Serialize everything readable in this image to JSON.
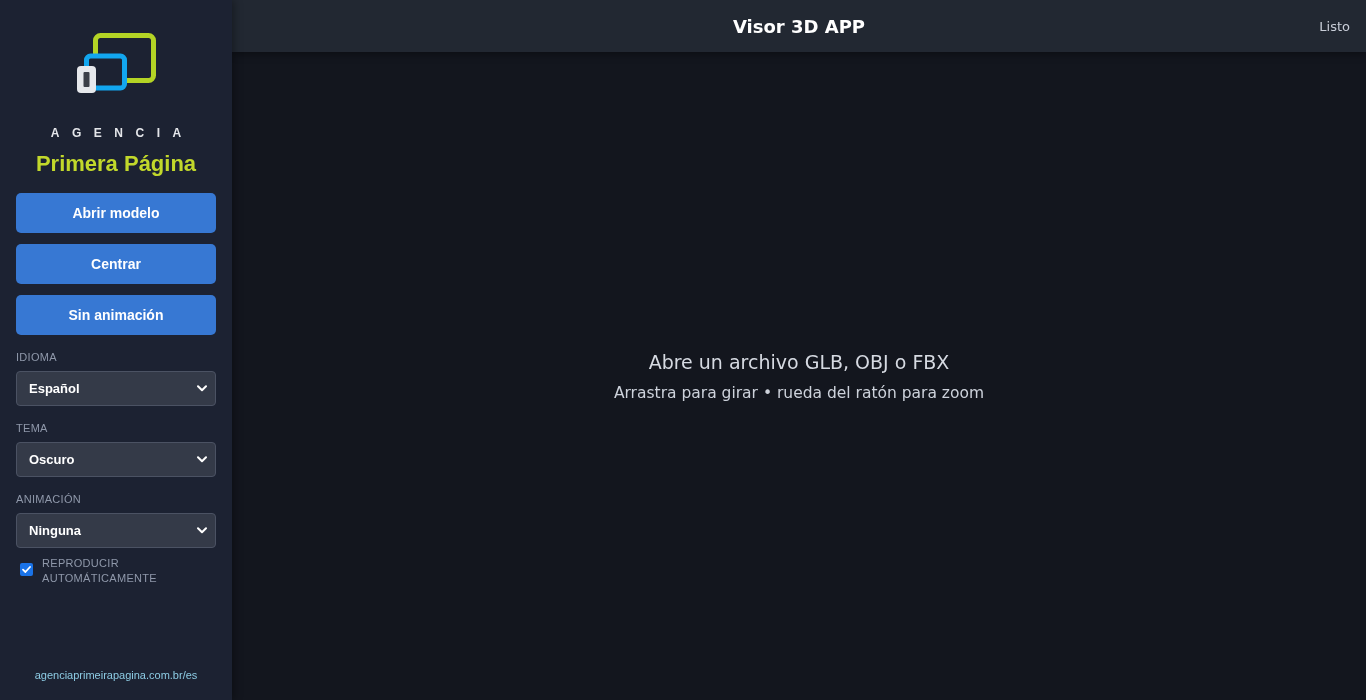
{
  "sidebar": {
    "logo": {
      "overline": "AGENCIA",
      "name": "Primera Página"
    },
    "buttons": [
      {
        "label": "Abrir modelo"
      },
      {
        "label": "Centrar"
      },
      {
        "label": "Sin animación"
      }
    ],
    "settings": [
      {
        "label": "IDIOMA",
        "value": "Español"
      },
      {
        "label": "TEMA",
        "value": "Oscuro"
      },
      {
        "label": "ANIMACIÓN",
        "value": "Ninguna"
      }
    ],
    "autoplay": {
      "label": "REPRODUCIR AUTOMÁTICAMENTE",
      "checked": true
    },
    "footer_link": "agenciaprimeirapagina.com.br/es"
  },
  "header": {
    "title": "Visor 3D APP",
    "status": "Listo"
  },
  "viewer": {
    "message": "Abre un archivo GLB, OBJ o FBX",
    "hint": "Arrastra para girar • rueda del ratón para zoom"
  }
}
